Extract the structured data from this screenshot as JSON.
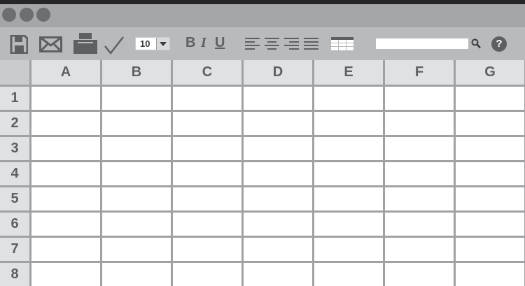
{
  "window": {
    "controls": [
      "close-dot",
      "minimize-dot",
      "maximize-dot"
    ]
  },
  "toolbar": {
    "icons": [
      "save-icon",
      "mail-icon",
      "print-icon",
      "checkmark-icon"
    ],
    "font_size": "10",
    "bold_label": "B",
    "italic_label": "I",
    "underline_label": "U",
    "align_icons": [
      "align-left-icon",
      "align-center-icon",
      "align-right-icon",
      "justify-icon"
    ],
    "table_icon": "table-icon",
    "search": {
      "value": "",
      "icon": "search-icon"
    },
    "help_label": "?"
  },
  "sheet": {
    "columns": [
      "A",
      "B",
      "C",
      "D",
      "E",
      "F",
      "G"
    ],
    "rows": [
      "1",
      "2",
      "3",
      "4",
      "5",
      "6",
      "7",
      "8"
    ]
  }
}
